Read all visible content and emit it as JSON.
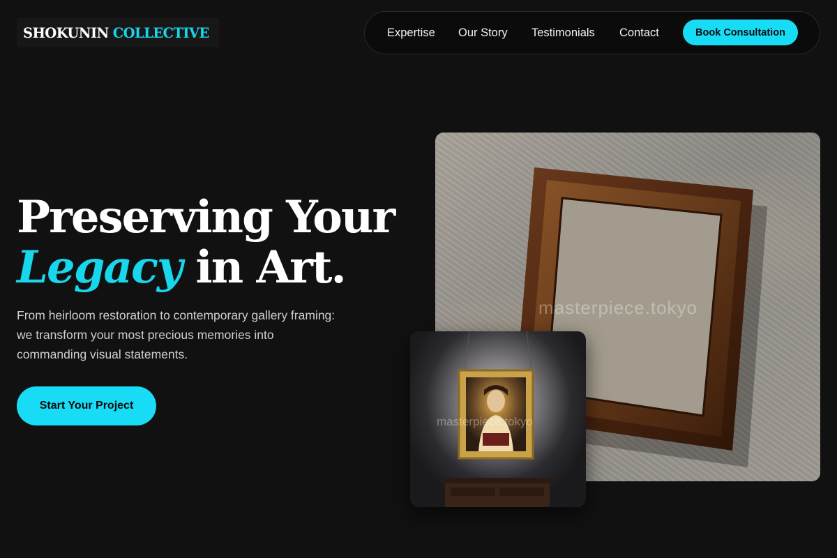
{
  "brand": {
    "name_primary": "SHOKUNIN",
    "name_accent": "COLLECTIVE"
  },
  "nav": {
    "links": [
      "Expertise",
      "Our Story",
      "Testimonials",
      "Contact"
    ],
    "cta_label": "Book Consultation"
  },
  "hero": {
    "headline_line1": "Preserving Your",
    "headline_accent": "Legacy",
    "headline_line2_rest": " in Art.",
    "subtext": "From heirloom restoration to contemporary gallery framing: we transform your most precious memories into commanding visual statements.",
    "cta_label": "Start Your Project"
  },
  "images": {
    "main_watermark": "masterpiece.tokyo",
    "small_watermark": "masterpiece.tokyo"
  },
  "colors": {
    "accent": "#18dcf5",
    "background": "#111112"
  }
}
